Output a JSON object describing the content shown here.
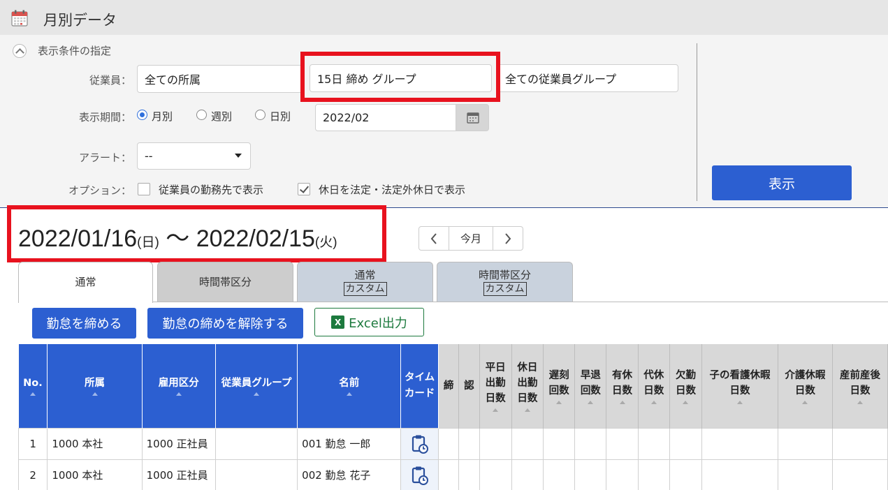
{
  "header": {
    "title": "月別データ",
    "icon": "calendar-icon"
  },
  "conditions": {
    "title": "表示条件の指定",
    "employee_label": "従業員：",
    "department_value": "全ての所属",
    "group_value": "15日 締め グループ",
    "employee_group_value": "全ての従業員グループ",
    "period_label": "表示期間：",
    "period_options": [
      "月別",
      "週別",
      "日別"
    ],
    "period_selected": "月別",
    "date_value": "2022/02",
    "alert_label": "アラート：",
    "alert_value": "--",
    "option_label": "オプション：",
    "option1": "従業員の勤務先で表示",
    "option1_checked": false,
    "option2": "休日を法定・法定外休日で表示",
    "option2_checked": true,
    "show_button": "表示"
  },
  "period": {
    "start": "2022/01/16",
    "start_day": "(日)",
    "tilde": "〜",
    "end": "2022/02/15",
    "end_day": "(火)",
    "today_button": "今月"
  },
  "tabs": [
    {
      "label": "通常",
      "active": true
    },
    {
      "label": "時間帯区分",
      "active": false
    },
    {
      "label": "通常",
      "sub": "カスタム",
      "active": false
    },
    {
      "label": "時間帯区分",
      "sub": "カスタム",
      "active": false
    }
  ],
  "actions": {
    "close_button": "勤怠を締める",
    "unclose_button": "勤怠の締めを解除する",
    "excel_button": "Excel出力"
  },
  "table": {
    "headers": [
      {
        "l1": "No.",
        "l2": "",
        "l3": ""
      },
      {
        "l1": "所属",
        "l2": "",
        "l3": ""
      },
      {
        "l1": "雇用区分",
        "l2": "",
        "l3": ""
      },
      {
        "l1": "従業員グループ",
        "l2": "",
        "l3": ""
      },
      {
        "l1": "名前",
        "l2": "",
        "l3": ""
      },
      {
        "l1": "タイム",
        "l2": "カード",
        "l3": ""
      },
      {
        "l1": "締",
        "l2": "",
        "l3": ""
      },
      {
        "l1": "認",
        "l2": "",
        "l3": ""
      },
      {
        "l1": "平日",
        "l2": "出勤",
        "l3": "日数"
      },
      {
        "l1": "休日",
        "l2": "出勤",
        "l3": "日数"
      },
      {
        "l1": "遅刻",
        "l2": "回数",
        "l3": ""
      },
      {
        "l1": "早退",
        "l2": "回数",
        "l3": ""
      },
      {
        "l1": "有休",
        "l2": "日数",
        "l3": ""
      },
      {
        "l1": "代休",
        "l2": "日数",
        "l3": ""
      },
      {
        "l1": "欠勤",
        "l2": "日数",
        "l3": ""
      },
      {
        "l1": "子の看護休暇",
        "l2": "日数",
        "l3": ""
      },
      {
        "l1": "介護休暇",
        "l2": "日数",
        "l3": ""
      },
      {
        "l1": "産前産後",
        "l2": "日数",
        "l3": ""
      }
    ],
    "rows": [
      {
        "no": "1",
        "dept": "1000 本社",
        "emp_type": "1000 正社員",
        "group": "",
        "name": "001 勤怠 一郎"
      },
      {
        "no": "2",
        "dept": "1000 本社",
        "emp_type": "1000 正社員",
        "group": "",
        "name": "002 勤怠 花子"
      }
    ]
  }
}
